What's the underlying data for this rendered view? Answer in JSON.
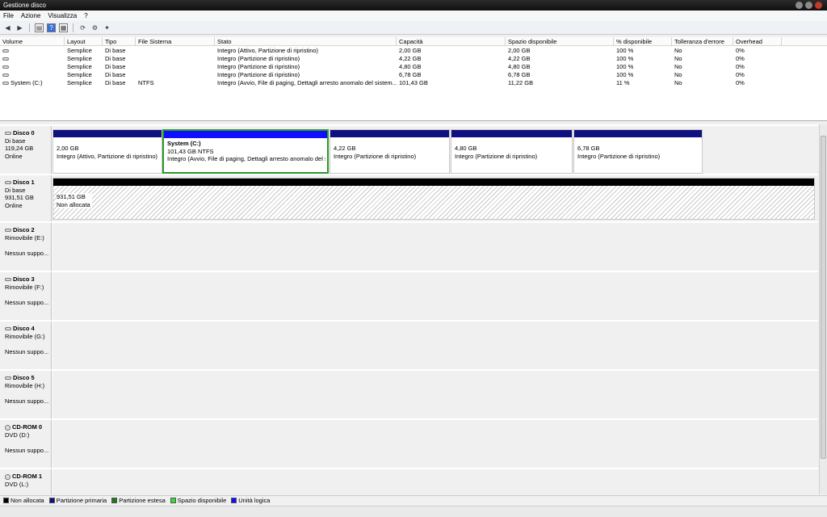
{
  "window": {
    "title": "Gestione disco"
  },
  "menu": [
    "File",
    "Azione",
    "Visualizza",
    "?"
  ],
  "toolbar_icons": [
    "back-arrow-icon",
    "forward-arrow-icon",
    "disk-list-icon",
    "help-icon",
    "properties-icon",
    "refresh-icon",
    "settings-icon",
    "wizard-icon"
  ],
  "volume_table": {
    "headers": [
      "Volume",
      "Layout",
      "Tipo",
      "File Sistema",
      "Stato",
      "Capacità",
      "Spazio disponibile",
      "% disponibile",
      "Tolleranza d'errore",
      "Overhead"
    ],
    "rows": [
      [
        "",
        "Semplice",
        "Di base",
        "",
        "Integro (Attivo, Partizione di ripristino)",
        "2,00 GB",
        "2,00 GB",
        "100 %",
        "No",
        "0%"
      ],
      [
        "",
        "Semplice",
        "Di base",
        "",
        "Integro (Partizione di ripristino)",
        "4,22 GB",
        "4,22 GB",
        "100 %",
        "No",
        "0%"
      ],
      [
        "",
        "Semplice",
        "Di base",
        "",
        "Integro (Partizione di ripristino)",
        "4,80 GB",
        "4,80 GB",
        "100 %",
        "No",
        "0%"
      ],
      [
        "",
        "Semplice",
        "Di base",
        "",
        "Integro (Partizione di ripristino)",
        "6,78 GB",
        "6,78 GB",
        "100 %",
        "No",
        "0%"
      ],
      [
        "System (C:)",
        "Semplice",
        "Di base",
        "NTFS",
        "Integro (Avvio, File di paging, Dettagli arresto anomalo del sistem...",
        "101,43 GB",
        "11,22 GB",
        "11 %",
        "No",
        "0%"
      ]
    ]
  },
  "disks": [
    {
      "name": "Disco 0",
      "l1": "Di base",
      "l2": "119,24 GB",
      "l3": "Online",
      "partitions": [
        {
          "title": "",
          "size": "2,00 GB",
          "status": "Integro (Attivo, Partizione di ripristino)"
        },
        {
          "title": "System  (C:)",
          "size": "101,43 GB NTFS",
          "status": "Integro (Avvio, File di paging, Dettagli arresto anomalo del s"
        },
        {
          "title": "",
          "size": "4,22 GB",
          "status": "Integro (Partizione di ripristino)"
        },
        {
          "title": "",
          "size": "4,80 GB",
          "status": "Integro (Partizione di ripristino)"
        },
        {
          "title": "",
          "size": "6,78 GB",
          "status": "Integro (Partizione di ripristino)"
        }
      ]
    },
    {
      "name": "Disco 1",
      "l1": "Di base",
      "l2": "931,51 GB",
      "l3": "Online",
      "partitions": [
        {
          "title": "",
          "size": "931,51 GB",
          "status": "Non allocata"
        }
      ]
    },
    {
      "name": "Disco 2",
      "l1": "Rimovibile (E:)",
      "l2": "",
      "l3": "Nessun suppo..."
    },
    {
      "name": "Disco 3",
      "l1": "Rimovibile (F:)",
      "l2": "",
      "l3": "Nessun suppo..."
    },
    {
      "name": "Disco 4",
      "l1": "Rimovibile (G:)",
      "l2": "",
      "l3": "Nessun suppo..."
    },
    {
      "name": "Disco 5",
      "l1": "Rimovibile (H:)",
      "l2": "",
      "l3": "Nessun suppo..."
    },
    {
      "name": "CD-ROM 0",
      "l1": "DVD (D:)",
      "l2": "",
      "l3": "Nessun suppo..."
    },
    {
      "name": "CD-ROM 1",
      "l1": "DVD (L:)",
      "l2": "",
      "l3": ""
    }
  ],
  "legend": [
    {
      "label": "Non allocata",
      "color": "#000000"
    },
    {
      "label": "Partizione primaria",
      "color": "#101080"
    },
    {
      "label": "Partizione estesa",
      "color": "#1c7a1c"
    },
    {
      "label": "Spazio disponibile",
      "color": "#33dd33"
    },
    {
      "label": "Unità logica",
      "color": "#1010ff"
    }
  ]
}
